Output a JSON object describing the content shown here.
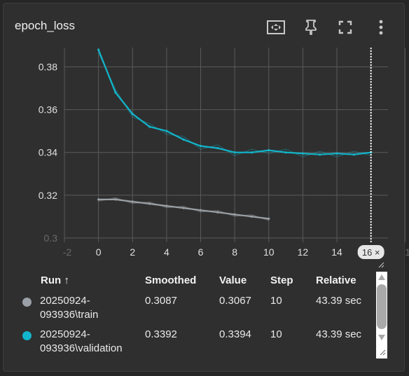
{
  "card": {
    "title": "epoch_loss"
  },
  "toolbar": {
    "icons": [
      "fit-domain-icon",
      "pin-icon",
      "fullscreen-icon",
      "more-vert-icon"
    ]
  },
  "chart_data": {
    "type": "line",
    "xlim": [
      -2,
      17
    ],
    "ylim": [
      0.298,
      0.389
    ],
    "x_ticks": [
      "-2",
      "0",
      "2",
      "4",
      "6",
      "8",
      "10",
      "12",
      "14",
      "16",
      "1"
    ],
    "y_ticks": [
      "0.3",
      "0.32",
      "0.34",
      "0.36",
      "0.38"
    ],
    "grid": true,
    "step_marker": {
      "x": 16,
      "label": "16 ×"
    },
    "colors": {
      "train": "#9aa0a6",
      "validation": "#12b5cb"
    },
    "series": [
      {
        "name": "20250924-093936\\train",
        "x": [
          0,
          1,
          2,
          3,
          4,
          5,
          6,
          7,
          8,
          9,
          10
        ],
        "y": [
          0.318,
          0.318,
          0.317,
          0.316,
          0.315,
          0.314,
          0.313,
          0.312,
          0.311,
          0.31,
          0.309
        ]
      },
      {
        "name": "20250924-093936\\validation",
        "x": [
          0,
          1,
          2,
          3,
          4,
          5,
          6,
          7,
          8,
          9,
          10,
          11,
          12,
          13,
          14,
          15,
          16
        ],
        "y": [
          0.388,
          0.368,
          0.358,
          0.352,
          0.35,
          0.346,
          0.343,
          0.342,
          0.34,
          0.34,
          0.341,
          0.34,
          0.3395,
          0.339,
          0.3395,
          0.339,
          0.34
        ]
      }
    ]
  },
  "table": {
    "headers": {
      "run": "Run ↑",
      "smoothed": "Smoothed",
      "value": "Value",
      "step": "Step",
      "relative": "Relative"
    },
    "rows": [
      {
        "run_line1": "20250924-",
        "run_line2": "093936\\train",
        "smoothed": "0.3087",
        "value": "0.3067",
        "step": "10",
        "relative": "43.39 sec",
        "color": "#9aa0a6"
      },
      {
        "run_line1": "20250924-",
        "run_line2": "093936\\validation",
        "smoothed": "0.3392",
        "value": "0.3394",
        "step": "10",
        "relative": "43.39 sec",
        "color": "#12b5cb"
      }
    ]
  }
}
